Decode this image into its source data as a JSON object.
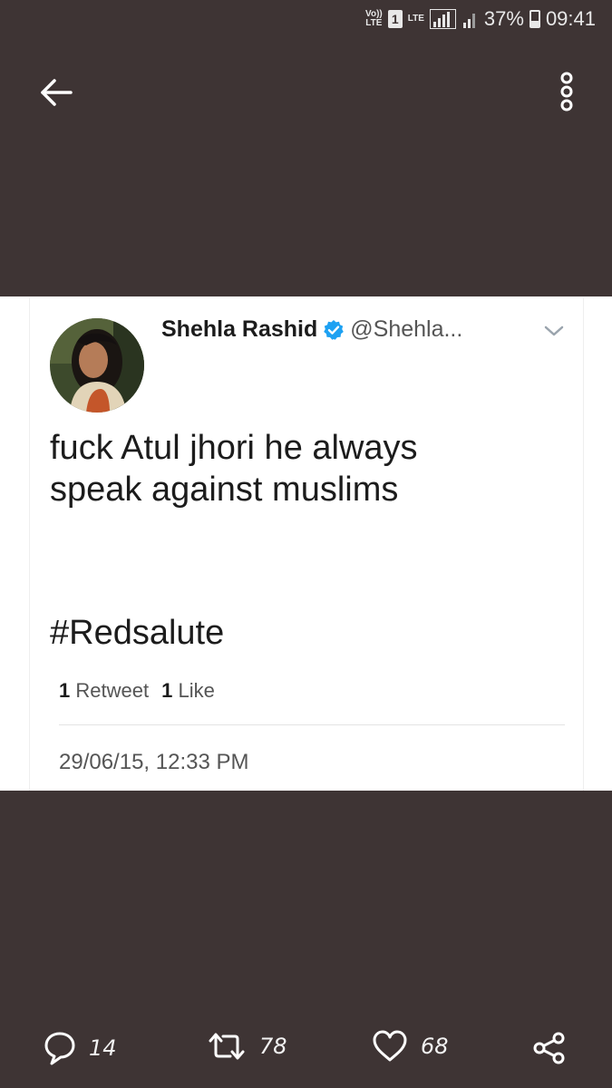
{
  "status_bar": {
    "volte_label": "Vo))",
    "volte_sub": "LTE",
    "sim": "1",
    "lte": "LTE",
    "battery_percent": "37%",
    "battery_level": 0.37,
    "time": "09:41"
  },
  "top_bar": {
    "back_icon": "arrow-left-icon",
    "more_icon": "more-vertical-icon"
  },
  "tweet": {
    "display_name": "Shehla Rashid",
    "handle": "@Shehla...",
    "verified_icon": "verified-badge-icon",
    "text_line1": "fuck Atul jhori he always",
    "text_line2": "speak against muslims",
    "hashtag": "#Redsalute",
    "retweet_count": "1",
    "retweet_label": "Retweet",
    "like_count": "1",
    "like_label": "Like",
    "timestamp": "29/06/15, 12:33 PM"
  },
  "actions": {
    "reply_count": "14",
    "retweet_count": "78",
    "like_count": "68",
    "share_icon": "share-icon"
  },
  "colors": {
    "background": "#3e3434",
    "verified_blue": "#1da1f2"
  }
}
